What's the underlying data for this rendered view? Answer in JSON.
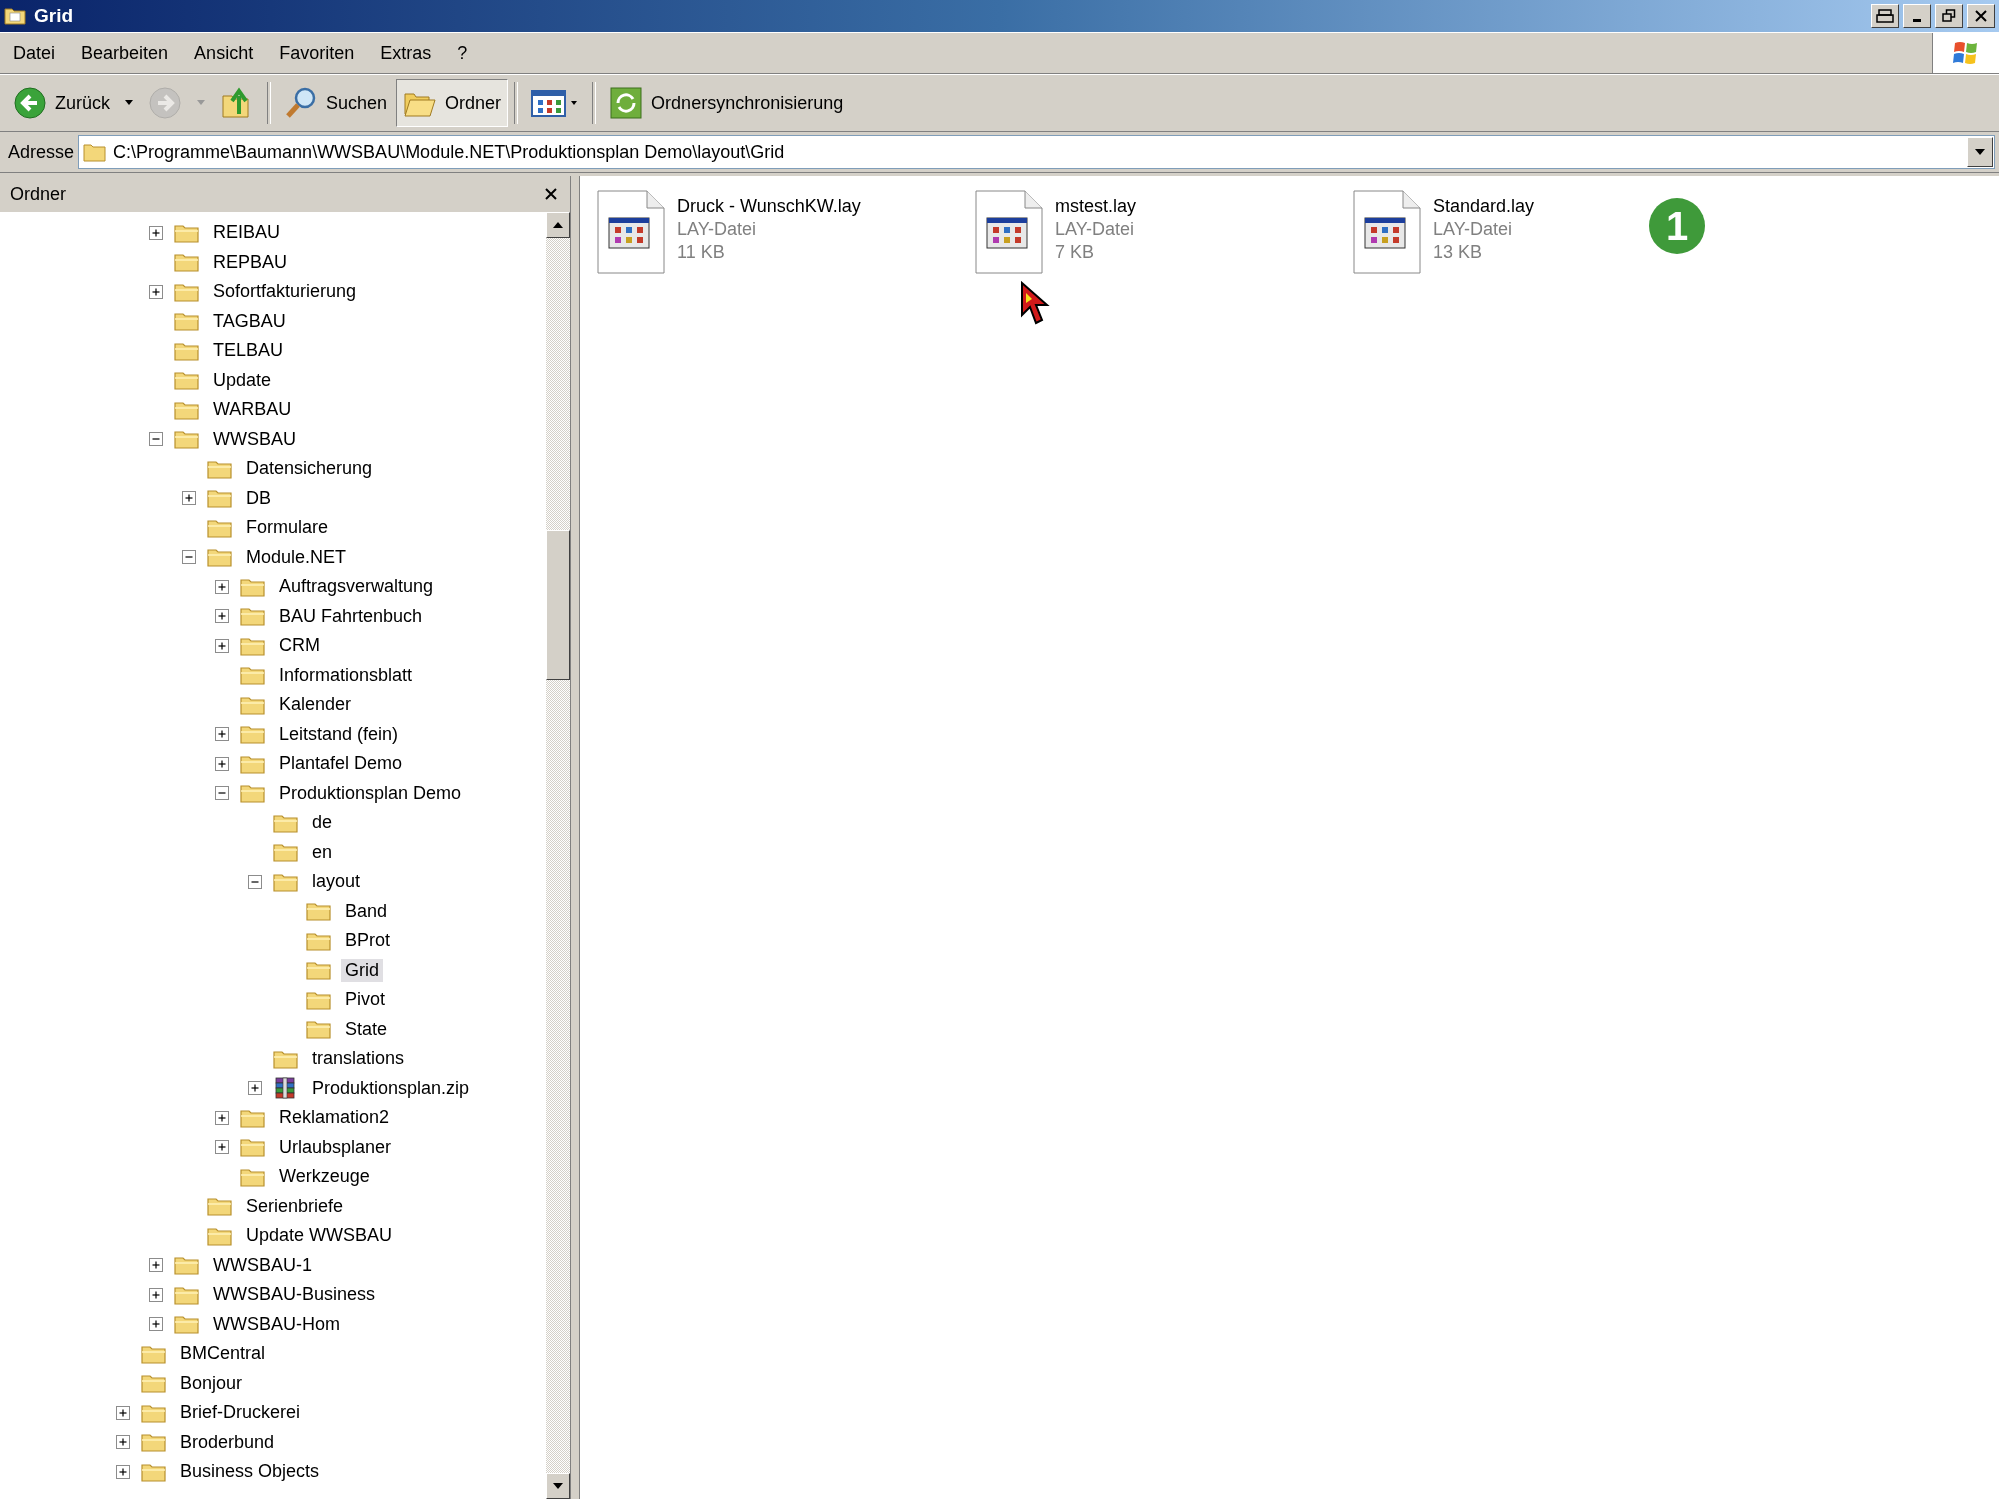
{
  "window": {
    "title": "Grid"
  },
  "menu": [
    "Datei",
    "Bearbeiten",
    "Ansicht",
    "Favoriten",
    "Extras",
    "?"
  ],
  "toolbar": [
    {
      "kind": "back",
      "label": "Zurück",
      "disabled": false,
      "pressed": false
    },
    {
      "kind": "forward",
      "disabled": true,
      "pressed": false
    },
    {
      "kind": "up",
      "disabled": false,
      "pressed": false
    },
    {
      "kind": "search",
      "label": "Suchen",
      "disabled": false,
      "pressed": false
    },
    {
      "kind": "folders",
      "label": "Ordner",
      "disabled": false,
      "pressed": true
    },
    {
      "kind": "views",
      "disabled": false,
      "pressed": false
    },
    {
      "kind": "sync",
      "label": "Ordnersynchronisierung",
      "disabled": false,
      "pressed": false
    }
  ],
  "address": {
    "label": "Adresse",
    "value": "C:\\Programme\\Baumann\\WWSBAU\\Module.NET\\Produktionsplan Demo\\layout\\Grid"
  },
  "folder_pane": {
    "title": "Ordner",
    "items": [
      {
        "children": [
          {
            "label": "REIBAU",
            "kind": "folder",
            "expanded": false,
            "selected": false
          },
          {
            "label": "REPBAU",
            "kind": "folder",
            "selected": false
          },
          {
            "label": "Sofortfakturierung",
            "kind": "folder",
            "expanded": false,
            "selected": false
          },
          {
            "label": "TAGBAU",
            "kind": "folder",
            "selected": false
          },
          {
            "label": "TELBAU",
            "kind": "folder",
            "selected": false
          },
          {
            "label": "Update",
            "kind": "folder",
            "selected": false
          },
          {
            "label": "WARBAU",
            "kind": "folder",
            "selected": false
          },
          {
            "label": "WWSBAU",
            "kind": "folder",
            "expanded": true,
            "selected": false,
            "children": [
              {
                "label": "Datensicherung",
                "kind": "folder",
                "selected": false
              },
              {
                "label": "DB",
                "kind": "folder",
                "expanded": false,
                "selected": false
              },
              {
                "label": "Formulare",
                "kind": "folder",
                "selected": false
              },
              {
                "label": "Module.NET",
                "kind": "folder",
                "expanded": true,
                "selected": false,
                "children": [
                  {
                    "label": "Auftragsverwaltung",
                    "kind": "folder",
                    "expanded": false,
                    "selected": false
                  },
                  {
                    "label": "BAU Fahrtenbuch",
                    "kind": "folder",
                    "expanded": false,
                    "selected": false
                  },
                  {
                    "label": "CRM",
                    "kind": "folder",
                    "expanded": false,
                    "selected": false
                  },
                  {
                    "label": "Informationsblatt",
                    "kind": "folder",
                    "selected": false
                  },
                  {
                    "label": "Kalender",
                    "kind": "folder",
                    "selected": false
                  },
                  {
                    "label": "Leitstand (fein)",
                    "kind": "folder",
                    "expanded": false,
                    "selected": false
                  },
                  {
                    "label": "Plantafel Demo",
                    "kind": "folder",
                    "expanded": false,
                    "selected": false
                  },
                  {
                    "label": "Produktionsplan Demo",
                    "kind": "folder",
                    "expanded": true,
                    "selected": false,
                    "children": [
                      {
                        "label": "de",
                        "kind": "folder",
                        "selected": false
                      },
                      {
                        "label": "en",
                        "kind": "folder",
                        "selected": false
                      },
                      {
                        "label": "layout",
                        "kind": "folder",
                        "expanded": true,
                        "selected": false,
                        "children": [
                          {
                            "label": "Band",
                            "kind": "folder",
                            "selected": false
                          },
                          {
                            "label": "BProt",
                            "kind": "folder",
                            "selected": false
                          },
                          {
                            "label": "Grid",
                            "kind": "folder",
                            "selected": true
                          },
                          {
                            "label": "Pivot",
                            "kind": "folder",
                            "selected": false
                          },
                          {
                            "label": "State",
                            "kind": "folder",
                            "selected": false
                          }
                        ]
                      },
                      {
                        "label": "translations",
                        "kind": "folder",
                        "selected": false
                      },
                      {
                        "label": "Produktionsplan.zip",
                        "kind": "zip",
                        "expanded": false,
                        "selected": false
                      }
                    ]
                  },
                  {
                    "label": "Reklamation2",
                    "kind": "folder",
                    "expanded": false,
                    "selected": false
                  },
                  {
                    "label": "Urlaubsplaner",
                    "kind": "folder",
                    "expanded": false,
                    "selected": false
                  },
                  {
                    "label": "Werkzeuge",
                    "kind": "folder",
                    "selected": false
                  }
                ]
              },
              {
                "label": "Serienbriefe",
                "kind": "folder",
                "selected": false
              },
              {
                "label": "Update WWSBAU",
                "kind": "folder",
                "selected": false
              }
            ]
          },
          {
            "label": "WWSBAU-1",
            "kind": "folder",
            "expanded": false,
            "selected": false
          },
          {
            "label": "WWSBAU-Business",
            "kind": "folder",
            "expanded": false,
            "selected": false
          },
          {
            "label": "WWSBAU-Hom",
            "kind": "folder",
            "expanded": false,
            "selected": false
          }
        ]
      },
      {
        "label": "BMCentral",
        "kind": "folder",
        "selected": false
      },
      {
        "label": "Bonjour",
        "kind": "folder",
        "selected": false
      },
      {
        "label": "Brief-Druckerei",
        "kind": "folder",
        "expanded": false,
        "selected": false
      },
      {
        "label": "Broderbund",
        "kind": "folder",
        "expanded": false,
        "selected": false
      },
      {
        "label": "Business Objects",
        "kind": "folder",
        "expanded": false,
        "selected": false
      }
    ]
  },
  "files": [
    {
      "name": "Druck - WunschKW.lay",
      "type": "LAY-Datei",
      "size": "11 KB"
    },
    {
      "name": "mstest.lay",
      "type": "LAY-Datei",
      "size": "7 KB"
    },
    {
      "name": "Standard.lay",
      "type": "LAY-Datei",
      "size": "13 KB"
    }
  ],
  "marker": {
    "label": "1"
  }
}
